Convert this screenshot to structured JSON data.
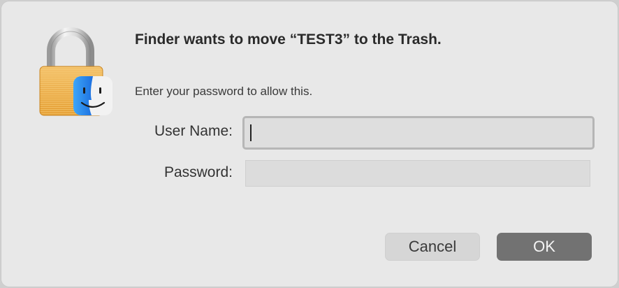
{
  "dialog": {
    "title": "Finder wants to move “TEST3” to the Trash.",
    "subtitle": "Enter your password to allow this.",
    "icon": "lock-with-finder-icon"
  },
  "form": {
    "username_label": "User Name:",
    "username_value": "",
    "password_label": "Password:",
    "password_value": ""
  },
  "buttons": {
    "cancel_label": "Cancel",
    "ok_label": "OK"
  },
  "colors": {
    "dialog_bg": "#e8e8e8",
    "ok_button": "#727272",
    "cancel_button": "#d6d6d6",
    "lock_gold": "#e9a23b",
    "finder_blue": "#2f8cf0"
  }
}
